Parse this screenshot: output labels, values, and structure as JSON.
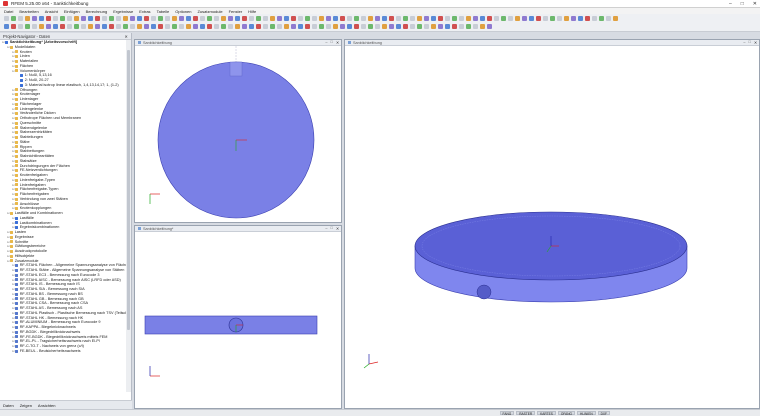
{
  "window": {
    "title": "RFEM 5.25.00 x64 - Sanktichkeitbung"
  },
  "menu": [
    "Datei",
    "Bearbeiten",
    "Ansicht",
    "Einfügen",
    "Berechnung",
    "Ergebnisse",
    "Extras",
    "Tabelle",
    "Optionen",
    "Zusatzmodule",
    "Fenster",
    "Hilfe"
  ],
  "navigator": {
    "title": "Projekt-Navigator - Daten",
    "rows": [
      {
        "t": "Sanktichkeitbung* [Arbeitsvorschrift]",
        "l": 0,
        "c": "#3a6fd8",
        "b": true
      },
      {
        "t": "Modelldaten",
        "l": 1,
        "c": "#e8b84a"
      },
      {
        "t": "Knoten",
        "l": 2,
        "c": "#e8b84a"
      },
      {
        "t": "Linien",
        "l": 2,
        "c": "#e8b84a"
      },
      {
        "t": "Materialien",
        "l": 2,
        "c": "#e8b84a"
      },
      {
        "t": "Flächen",
        "l": 2,
        "c": "#e8b84a"
      },
      {
        "t": "Volumenkörper",
        "l": 2,
        "c": "#e8b84a"
      },
      {
        "t": "1: Nußl, 5,13,16",
        "l": 3,
        "c": "#3a6fd8"
      },
      {
        "t": "2: Nußl, 20-27",
        "l": 3,
        "c": "#3a6fd8"
      },
      {
        "t": "3: Material isotrop linear elastisch, 1,4,13,14,17; 1, (1-2)",
        "l": 3,
        "c": "#3a6fd8"
      },
      {
        "t": "Öffnungen",
        "l": 2,
        "c": "#e8b84a"
      },
      {
        "t": "Knotenlager",
        "l": 2,
        "c": "#e8b84a"
      },
      {
        "t": "Linienlager",
        "l": 2,
        "c": "#e8b84a"
      },
      {
        "t": "Flächenlager",
        "l": 2,
        "c": "#e8b84a"
      },
      {
        "t": "Liniengelenke",
        "l": 2,
        "c": "#e8b84a"
      },
      {
        "t": "Veränderliche Dicken",
        "l": 2,
        "c": "#e8b84a"
      },
      {
        "t": "Orthotrope Flächen und Membranen",
        "l": 2,
        "c": "#e8b84a"
      },
      {
        "t": "Querschnitte",
        "l": 2,
        "c": "#e8b84a"
      },
      {
        "t": "Stabendgelenke",
        "l": 2,
        "c": "#e8b84a"
      },
      {
        "t": "Stabexzentrizitäten",
        "l": 2,
        "c": "#e8b84a"
      },
      {
        "t": "Stabteilungen",
        "l": 2,
        "c": "#e8b84a"
      },
      {
        "t": "Stäbe",
        "l": 2,
        "c": "#e8b84a"
      },
      {
        "t": "Rippen",
        "l": 2,
        "c": "#e8b84a"
      },
      {
        "t": "Stabbettungen",
        "l": 2,
        "c": "#e8b84a"
      },
      {
        "t": "Stabnichtlinearitäten",
        "l": 2,
        "c": "#e8b84a"
      },
      {
        "t": "Stabsätze",
        "l": 2,
        "c": "#e8b84a"
      },
      {
        "t": "Durchdringungen der Flächen",
        "l": 2,
        "c": "#e8b84a"
      },
      {
        "t": "FE-Netzverdichtungen",
        "l": 2,
        "c": "#e8b84a"
      },
      {
        "t": "Knotenfreigaben",
        "l": 2,
        "c": "#e8b84a"
      },
      {
        "t": "Linienfreigabe-Typen",
        "l": 2,
        "c": "#e8b84a"
      },
      {
        "t": "Linienfreigaben",
        "l": 2,
        "c": "#e8b84a"
      },
      {
        "t": "Flächenfreigabe-Typen",
        "l": 2,
        "c": "#e8b84a"
      },
      {
        "t": "Flächenfreigaben",
        "l": 2,
        "c": "#e8b84a"
      },
      {
        "t": "Verbindung von zwei Stäben",
        "l": 2,
        "c": "#e8b84a"
      },
      {
        "t": "Anschlüsse",
        "l": 2,
        "c": "#e8b84a"
      },
      {
        "t": "Knotenkopplungen",
        "l": 2,
        "c": "#e8b84a"
      },
      {
        "t": "Lastfälle und Kombinationen",
        "l": 1,
        "c": "#e8b84a"
      },
      {
        "t": "Lastfälle",
        "l": 2,
        "c": "#3a6fd8"
      },
      {
        "t": "Lastkombinationen",
        "l": 2,
        "c": "#3a6fd8"
      },
      {
        "t": "Ergebniskombinationen",
        "l": 2,
        "c": "#3a6fd8"
      },
      {
        "t": "Lasten",
        "l": 1,
        "c": "#e8b84a"
      },
      {
        "t": "Ergebnisse",
        "l": 1,
        "c": "#e8b84a"
      },
      {
        "t": "Schnitte",
        "l": 1,
        "c": "#e8b84a"
      },
      {
        "t": "Glättungsbereiche",
        "l": 1,
        "c": "#e8b84a"
      },
      {
        "t": "Ausdruckprotokolle",
        "l": 1,
        "c": "#e8b84a"
      },
      {
        "t": "Hilfsobjekte",
        "l": 1,
        "c": "#e8b84a"
      },
      {
        "t": "Zusatzmodule",
        "l": 1,
        "c": "#e8b84a"
      },
      {
        "t": "RF-STAHL Flächen - Allgemeine Spannungsanalyse von Flächen",
        "l": 2,
        "c": "#5577cc"
      },
      {
        "t": "RF-STAHL Stäbe - Allgemeine Spannungsanalyse von Stäben",
        "l": 2,
        "c": "#5577cc"
      },
      {
        "t": "RF-STAHL EC3 - Bemessung nach Eurocode 3",
        "l": 2,
        "c": "#5577cc"
      },
      {
        "t": "RF-STAHL AISC - Bemessung nach AISC (LRFD oder ASD)",
        "l": 2,
        "c": "#5577cc"
      },
      {
        "t": "RF-STAHL IS - Bemessung nach IS",
        "l": 2,
        "c": "#5577cc"
      },
      {
        "t": "RF-STAHL SIA - Bemessung nach SIA",
        "l": 2,
        "c": "#5577cc"
      },
      {
        "t": "RF-STAHL BS - Bemessung nach BS",
        "l": 2,
        "c": "#5577cc"
      },
      {
        "t": "RF-STAHL GB - Bemessung nach GB",
        "l": 2,
        "c": "#5577cc"
      },
      {
        "t": "RF-STAHL CSA - Bemessung nach CSA",
        "l": 2,
        "c": "#5577cc"
      },
      {
        "t": "RF-STAHL AS - Bemessung nach AS",
        "l": 2,
        "c": "#5577cc"
      },
      {
        "t": "RF-STAHL Plastisch - Plastische Bemessung nach TSV (Teilschnittgrößenverfahren)",
        "l": 2,
        "c": "#5577cc"
      },
      {
        "t": "RF-STAHL HK - Bemessung nach HK",
        "l": 2,
        "c": "#5577cc"
      },
      {
        "t": "RF-ALUMINIUM - Bemessung nach Eurocode 9",
        "l": 2,
        "c": "#5577cc"
      },
      {
        "t": "RF-KAPPA - Biegeknicknachweis",
        "l": 2,
        "c": "#5577cc"
      },
      {
        "t": "RF-BGDK - Biegedrillknicknachweis",
        "l": 2,
        "c": "#5577cc"
      },
      {
        "t": "RF-FE-BGDK - Biegedrillknicknachweis mittels FEM",
        "l": 2,
        "c": "#5577cc"
      },
      {
        "t": "RF-EL-PL - Tragsicherheitsnachweis nach El-Pl",
        "l": 2,
        "c": "#5577cc"
      },
      {
        "t": "RF-C-TO-T - Nachweis von grenz (c/t)",
        "l": 2,
        "c": "#5577cc"
      },
      {
        "t": "FE-BEUL - Beulsicherheitsnachweis",
        "l": 2,
        "c": "#5577cc"
      }
    ],
    "tabs": [
      "Daten",
      "Zeigen",
      "Ansichten"
    ]
  },
  "views": {
    "top": {
      "title": "Sanktichkeitbung"
    },
    "front": {
      "title": "Sanktichkeitbung*"
    },
    "iso": {
      "title": "Sanktichkeitbung"
    }
  },
  "status": [
    "FANG",
    "RASTER",
    "KARTES",
    "OFANG",
    "HLINIEN",
    "DXF"
  ],
  "colors": {
    "solid": "#7a80e6",
    "solid_side": "#6b72de",
    "solid_edge": "#3a3fb0"
  }
}
